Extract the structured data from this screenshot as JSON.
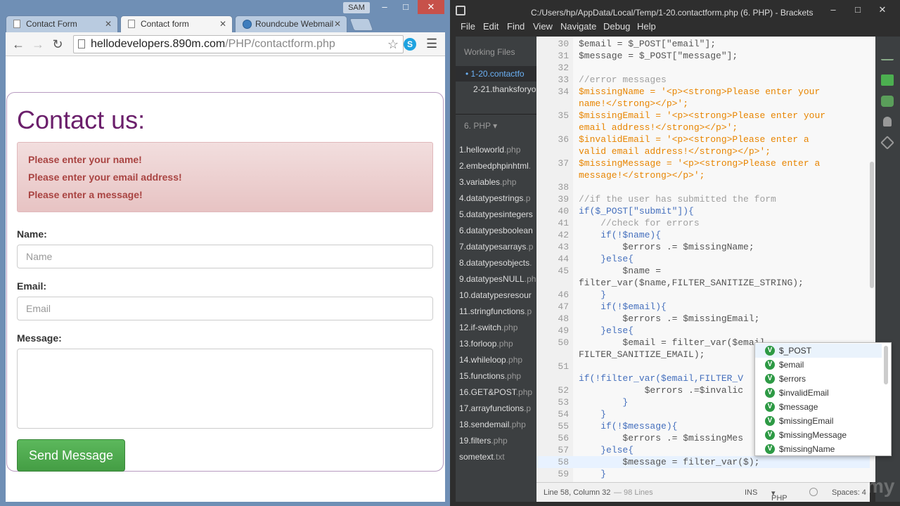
{
  "browser": {
    "user_badge": "SAM",
    "tabs": [
      {
        "label": "Contact Form"
      },
      {
        "label": "Contact form"
      },
      {
        "label": "Roundcube Webmail"
      }
    ],
    "url_host": "hellodevelopers.890m.com",
    "url_path": "/PHP/contactform.php",
    "skype_label": "S"
  },
  "page": {
    "title": "Contact us:",
    "errors": [
      "Please enter your name!",
      "Please enter your email address!",
      "Please enter a message!"
    ],
    "name_label": "Name:",
    "name_placeholder": "Name",
    "email_label": "Email:",
    "email_placeholder": "Email",
    "message_label": "Message:",
    "send_button": "Send Message"
  },
  "editor_app": {
    "title": "C:/Users/hp/AppData/Local/Temp/1-20.contactform.php (6. PHP) - Brackets",
    "menus": [
      "File",
      "Edit",
      "Find",
      "View",
      "Navigate",
      "Debug",
      "Help"
    ],
    "sidebar": {
      "working_files_label": "Working Files",
      "working_files": [
        "1-20.contactfo",
        "2-21.thanksforyo"
      ],
      "project_label": "6. PHP",
      "files": [
        {
          "name": "1.helloworld",
          "ext": ".php"
        },
        {
          "name": "2.embedphpinhtml",
          "ext": "."
        },
        {
          "name": "3.variables",
          "ext": ".php"
        },
        {
          "name": "4.datatypestrings",
          "ext": ".p"
        },
        {
          "name": "5.datatypesintegers",
          "ext": ""
        },
        {
          "name": "6.datatypesboolean",
          "ext": ""
        },
        {
          "name": "7.datatypesarrays",
          "ext": ".p"
        },
        {
          "name": "8.datatypesobjects",
          "ext": "."
        },
        {
          "name": "9.datatypesNULL",
          "ext": ".ph"
        },
        {
          "name": "10.datatypesresour",
          "ext": ""
        },
        {
          "name": "11.stringfunctions",
          "ext": ".p"
        },
        {
          "name": "12.if-switch",
          "ext": ".php"
        },
        {
          "name": "13.forloop",
          "ext": ".php"
        },
        {
          "name": "14.whileloop",
          "ext": ".php"
        },
        {
          "name": "15.functions",
          "ext": ".php"
        },
        {
          "name": "16.GET&POST",
          "ext": ".php"
        },
        {
          "name": "17.arrayfunctions",
          "ext": ".p"
        },
        {
          "name": "18.sendemail",
          "ext": ".php"
        },
        {
          "name": "19.filters",
          "ext": ".php"
        },
        {
          "name": "sometext",
          "ext": ".txt"
        }
      ]
    },
    "code_lines": [
      {
        "n": "30",
        "t": "$email = $_POST[\"email\"];"
      },
      {
        "n": "31",
        "t": "$message = $_POST[\"message\"];"
      },
      {
        "n": "32",
        "t": ""
      },
      {
        "n": "33",
        "t": "//error messages"
      },
      {
        "n": "34",
        "t": "$missingName = '<p><strong>Please enter your"
      },
      {
        "n": "",
        "t": "name!</strong></p>';"
      },
      {
        "n": "35",
        "t": "$missingEmail = '<p><strong>Please enter your"
      },
      {
        "n": "",
        "t": "email address!</strong></p>';"
      },
      {
        "n": "36",
        "t": "$invalidEmail = '<p><strong>Please enter a"
      },
      {
        "n": "",
        "t": "valid email address!</strong></p>';"
      },
      {
        "n": "37",
        "t": "$missingMessage = '<p><strong>Please enter a"
      },
      {
        "n": "",
        "t": "message!</strong></p>';"
      },
      {
        "n": "38",
        "t": ""
      },
      {
        "n": "39",
        "t": "//if the user has submitted the form"
      },
      {
        "n": "40",
        "t": "if($_POST[\"submit\"]){"
      },
      {
        "n": "41",
        "t": "    //check for errors"
      },
      {
        "n": "42",
        "t": "    if(!$name){"
      },
      {
        "n": "43",
        "t": "        $errors .= $missingName;"
      },
      {
        "n": "44",
        "t": "    }else{"
      },
      {
        "n": "45",
        "t": "        $name ="
      },
      {
        "n": "",
        "t": "filter_var($name,FILTER_SANITIZE_STRING);"
      },
      {
        "n": "46",
        "t": "    }"
      },
      {
        "n": "47",
        "t": "    if(!$email){"
      },
      {
        "n": "48",
        "t": "        $errors .= $missingEmail;"
      },
      {
        "n": "49",
        "t": "    }else{"
      },
      {
        "n": "50",
        "t": "        $email = filter_var($email,"
      },
      {
        "n": "",
        "t": "FILTER_SANITIZE_EMAIL);"
      },
      {
        "n": "51",
        "t": ""
      },
      {
        "n": "",
        "t": "if(!filter_var($email,FILTER_V"
      },
      {
        "n": "52",
        "t": "            $errors .=$invalic"
      },
      {
        "n": "53",
        "t": "        }"
      },
      {
        "n": "54",
        "t": "    }"
      },
      {
        "n": "55",
        "t": "    if(!$message){"
      },
      {
        "n": "56",
        "t": "        $errors .= $missingMes"
      },
      {
        "n": "57",
        "t": "    }else{"
      },
      {
        "n": "58",
        "t": "        $message = filter_var($);"
      },
      {
        "n": "59",
        "t": "    }"
      }
    ],
    "code_hints": [
      "$_POST",
      "$email",
      "$errors",
      "$invalidEmail",
      "$message",
      "$missingEmail",
      "$missingMessage",
      "$missingName"
    ],
    "status": {
      "position": "Line 58, Column 32",
      "lines": "— 98 Lines",
      "mode": "INS",
      "language": "PHP",
      "spaces": "Spaces: 4"
    },
    "watermark": "my"
  }
}
